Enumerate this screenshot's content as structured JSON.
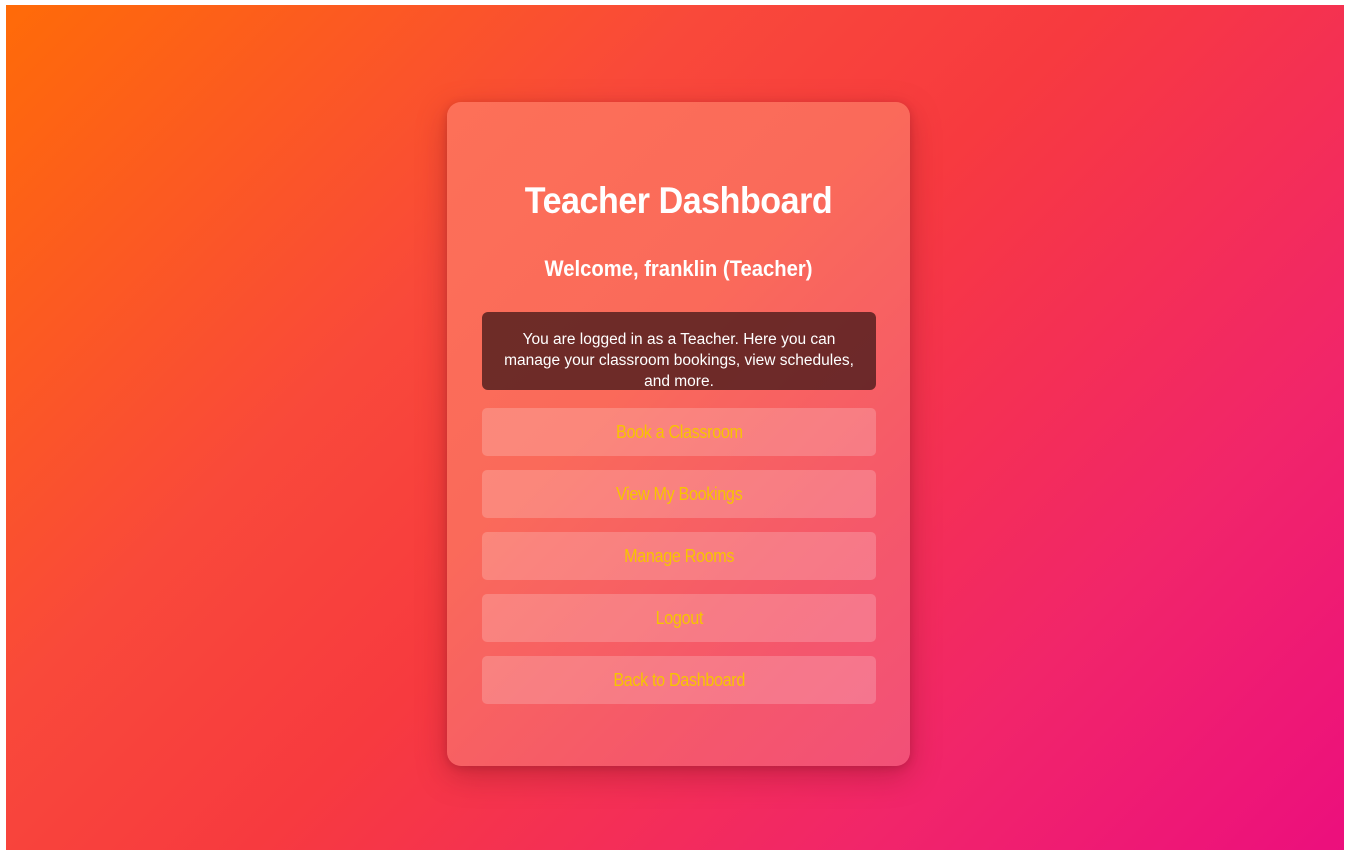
{
  "page": {
    "title": "Teacher Dashboard",
    "welcome": "Welcome, franklin (Teacher)",
    "info_text": "You are logged in as a Teacher. Here you can manage your classroom bookings, view schedules, and more."
  },
  "actions": [
    {
      "label": "Book a Classroom"
    },
    {
      "label": "View My Bookings"
    },
    {
      "label": "Manage Rooms"
    },
    {
      "label": "Logout"
    },
    {
      "label": "Back to Dashboard"
    }
  ],
  "colors": {
    "background_gradient_start": "#ff6b08",
    "background_gradient_end": "#ec0f7d",
    "button_text": "#f7c400",
    "info_box": "#5a2a2a"
  }
}
